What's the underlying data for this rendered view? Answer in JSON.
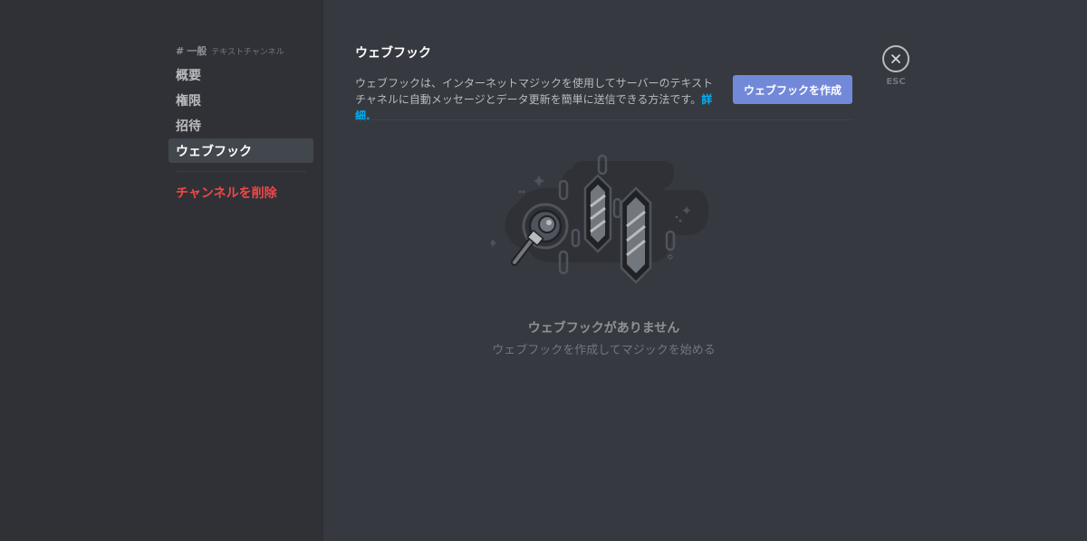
{
  "sidebar": {
    "header": {
      "hash": "#",
      "channel": "一般",
      "type": "テキストチャンネル"
    },
    "items": [
      {
        "label": "概要",
        "selected": false
      },
      {
        "label": "権限",
        "selected": false
      },
      {
        "label": "招待",
        "selected": false
      },
      {
        "label": "ウェブフック",
        "selected": true
      }
    ],
    "delete_label": "チャンネルを削除"
  },
  "main": {
    "title": "ウェブフック",
    "description": "ウェブフックは、インターネットマジックを使用してサーバーのテキストチャネルに自動メッセージとデータ更新を簡単に送信できる方法です。",
    "learn_more": "詳細.",
    "create_button": "ウェブフックを作成",
    "empty_title": "ウェブフックがありません",
    "empty_subtitle": "ウェブフックを作成してマジックを始める"
  },
  "close": {
    "icon": "close-icon",
    "label": "ESC"
  },
  "colors": {
    "background": "#36393f",
    "sidebar": "#2f3136",
    "accent": "#7289da",
    "danger": "#f04747",
    "link": "#00b0f4"
  }
}
